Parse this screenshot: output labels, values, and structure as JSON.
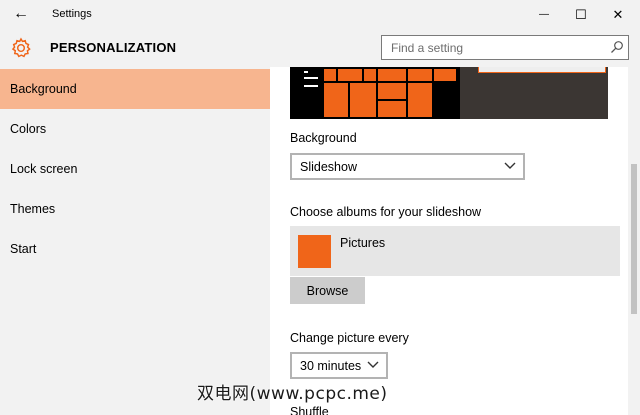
{
  "window": {
    "title": "Settings",
    "back_icon": "←",
    "minimize_icon": "—",
    "maximize_icon": "☐",
    "close_icon": "✕"
  },
  "header": {
    "title": "PERSONALIZATION",
    "search_placeholder": "Find a setting"
  },
  "sidebar": {
    "items": [
      {
        "label": "Background",
        "active": true
      },
      {
        "label": "Colors"
      },
      {
        "label": "Lock screen"
      },
      {
        "label": "Themes"
      },
      {
        "label": "Start"
      }
    ]
  },
  "content": {
    "background_label": "Background",
    "background_value": "Slideshow",
    "albums_label": "Choose albums for your slideshow",
    "album_name": "Pictures",
    "browse_label": "Browse",
    "interval_label": "Change picture every",
    "interval_value": "30 minutes",
    "shuffle_label": "Shuffle"
  },
  "watermark": "双电网(www.pcpc.me)",
  "colors": {
    "accent": "#f06519",
    "active_nav": "#f7b58f",
    "sidebar_bg": "#f2f2f2"
  }
}
